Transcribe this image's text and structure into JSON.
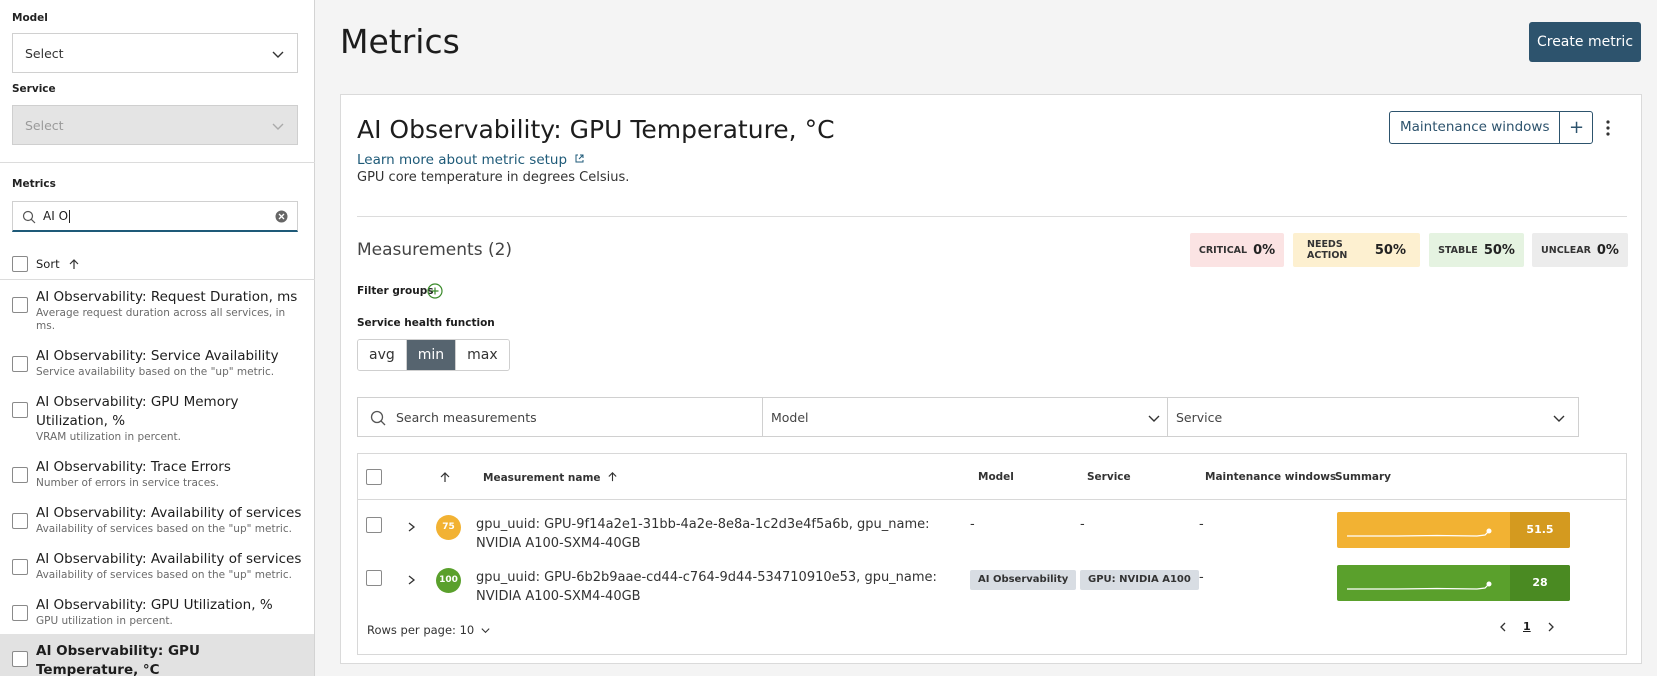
{
  "sidebar": {
    "model_label": "Model",
    "model_placeholder": "Select",
    "service_label": "Service",
    "service_placeholder": "Select",
    "metrics_label": "Metrics",
    "search_value": "AI O",
    "sort_label": "Sort",
    "metrics": [
      {
        "name": "AI Observability: Request Duration, ms",
        "desc": "Average request duration across all services, in ms."
      },
      {
        "name": "AI Observability: Service Availability",
        "desc": "Service availability based on the \"up\" metric."
      },
      {
        "name": "AI Observability: GPU Memory Utilization, %",
        "desc": "VRAM utilization in percent."
      },
      {
        "name": "AI Observability: Trace Errors",
        "desc": "Number of errors in service traces."
      },
      {
        "name": "AI Observability: Availability of services",
        "desc": "Availability of services based on the \"up\" metric."
      },
      {
        "name": "AI Observability: Availability of services",
        "desc": "Availability of services based on the \"up\" metric."
      },
      {
        "name": "AI Observability: GPU Utilization, %",
        "desc": "GPU utilization in percent."
      },
      {
        "name": "AI Observability: GPU Temperature, °C",
        "desc": "GPU core temperature in degrees Celsius.",
        "selected": true
      }
    ]
  },
  "main": {
    "page_title": "Metrics",
    "create_button": "Create metric",
    "card": {
      "title": "AI Observability: GPU Temperature, °C",
      "learn_link": "Learn more about metric setup",
      "description": "GPU core temperature in degrees Celsius.",
      "maintenance_button": "Maintenance windows",
      "maintenance_add": "+",
      "measurements_title": "Measurements (2)",
      "status_badges": [
        {
          "label": "CRITICAL",
          "value": "0%",
          "color": "#fbe3e3"
        },
        {
          "label": "NEEDS ACTION",
          "value": "50%",
          "color": "#fdf0d0"
        },
        {
          "label": "STABLE",
          "value": "50%",
          "color": "#e5f3e1"
        },
        {
          "label": "UNCLEAR",
          "value": "0%",
          "color": "#ececec"
        }
      ],
      "filter_groups_label": "Filter groups",
      "health_function_label": "Service health function",
      "health_options": [
        "avg",
        "min",
        "max"
      ],
      "health_selected": "min",
      "search_placeholder": "Search measurements",
      "model_filter": "Model",
      "service_filter": "Service",
      "table": {
        "headers": {
          "name": "Measurement name",
          "model": "Model",
          "service": "Service",
          "maintenance": "Maintenance windows",
          "summary": "Summary"
        },
        "rows": [
          {
            "score": "75",
            "score_color": "#f2b233",
            "name": "gpu_uuid: GPU-9f14a2e1-31bb-4a2e-8e8a-1c2d3e4f5a6b, gpu_name: NVIDIA A100-SXM4-40GB",
            "model": "-",
            "service": "-",
            "maintenance": "-",
            "summary_value": "51.5",
            "summary_color": "#f2b233",
            "summary_dark": "#d49a1f"
          },
          {
            "score": "100",
            "score_color": "#5aa02c",
            "name": "gpu_uuid: GPU-6b2b9aae-cd44-c764-9d44-534710910e53, gpu_name: NVIDIA A100-SXM4-40GB",
            "model": "AI Observability",
            "service": "GPU: NVIDIA A100",
            "maintenance": "-",
            "summary_value": "28",
            "summary_color": "#5aa02c",
            "summary_dark": "#4a8a22"
          }
        ]
      },
      "rows_per_page": "Rows per page: 10",
      "current_page": "1"
    }
  }
}
